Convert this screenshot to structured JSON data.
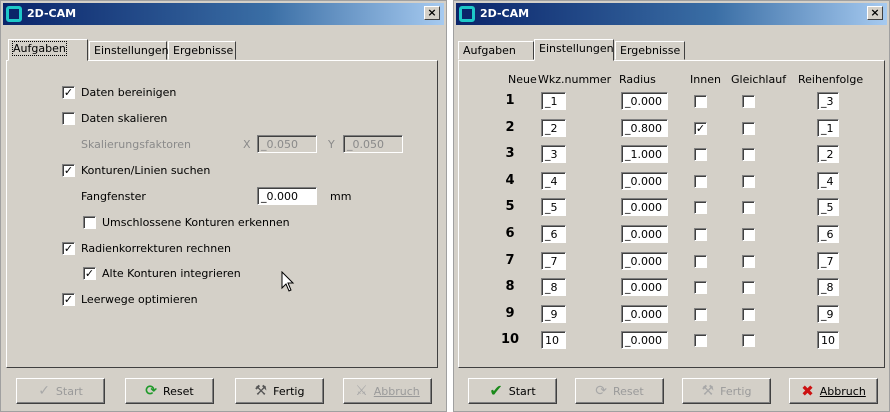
{
  "left": {
    "title": "2D-CAM",
    "close": "×",
    "tabs": [
      "Aufgaben",
      "Einstellungen",
      "Ergebnisse"
    ],
    "options": {
      "daten_bereinigen": {
        "label": "Daten bereinigen",
        "checked": true
      },
      "daten_skalieren": {
        "label": "Daten skalieren",
        "checked": false
      },
      "skalierungsfaktoren": {
        "label": "Skalierungsfaktoren",
        "x_label": "X",
        "x_value": "_0.050",
        "y_label": "Y",
        "y_value": "_0.050"
      },
      "konturen_suchen": {
        "label": "Konturen/Linien suchen",
        "checked": true
      },
      "fangfenster": {
        "label": "Fangfenster",
        "value": "_0.000",
        "unit": "mm"
      },
      "umschlossene": {
        "label": "Umschlossene Konturen erkennen",
        "checked": false
      },
      "radienkorrekturen": {
        "label": "Radienkorrekturen rechnen",
        "checked": true
      },
      "alte_konturen": {
        "label": "Alte Konturen integrieren",
        "checked": true
      },
      "leerwege": {
        "label": "Leerwege optimieren",
        "checked": true
      }
    },
    "buttons": {
      "start": "Start",
      "reset": "Reset",
      "fertig": "Fertig",
      "abbruch": "Abbruch"
    },
    "icons": {
      "start": "checkmark-icon",
      "reset": "refresh-icon",
      "fertig": "tools-icon",
      "abbruch": "tools-cross-icon"
    }
  },
  "right": {
    "title": "2D-CAM",
    "close": "×",
    "tabs": [
      "Aufgaben",
      "Einstellungen",
      "Ergebnisse"
    ],
    "headers": {
      "neue": "Neue",
      "wkz": "Wkz.nummer",
      "radius": "Radius",
      "innen": "Innen",
      "gleichlauf": "Gleichlauf",
      "reihenfolge": "Reihenfolge"
    },
    "rows": [
      {
        "num": "1",
        "wkz": "_1",
        "radius": "_0.000",
        "innen": false,
        "gleichlauf": false,
        "reihenfolge": "_3"
      },
      {
        "num": "2",
        "wkz": "_2",
        "radius": "_0.800",
        "innen": true,
        "gleichlauf": false,
        "reihenfolge": "_1"
      },
      {
        "num": "3",
        "wkz": "_3",
        "radius": "_1.000",
        "innen": false,
        "gleichlauf": false,
        "reihenfolge": "_2"
      },
      {
        "num": "4",
        "wkz": "_4",
        "radius": "_0.000",
        "innen": false,
        "gleichlauf": false,
        "reihenfolge": "_4"
      },
      {
        "num": "5",
        "wkz": "_5",
        "radius": "_0.000",
        "innen": false,
        "gleichlauf": false,
        "reihenfolge": "_5"
      },
      {
        "num": "6",
        "wkz": "_6",
        "radius": "_0.000",
        "innen": false,
        "gleichlauf": false,
        "reihenfolge": "_6"
      },
      {
        "num": "7",
        "wkz": "_7",
        "radius": "_0.000",
        "innen": false,
        "gleichlauf": false,
        "reihenfolge": "_7"
      },
      {
        "num": "8",
        "wkz": "_8",
        "radius": "_0.000",
        "innen": false,
        "gleichlauf": false,
        "reihenfolge": "_8"
      },
      {
        "num": "9",
        "wkz": "_9",
        "radius": "_0.000",
        "innen": false,
        "gleichlauf": false,
        "reihenfolge": "_9"
      },
      {
        "num": "10",
        "wkz": "10",
        "radius": "_0.000",
        "innen": false,
        "gleichlauf": false,
        "reihenfolge": "10"
      }
    ],
    "buttons": {
      "start": "Start",
      "reset": "Reset",
      "fertig": "Fertig",
      "abbruch": "Abbruch"
    },
    "icons": {
      "start": "checkmark-icon",
      "reset": "refresh-icon",
      "fertig": "tools-icon",
      "abbruch": "red-x-icon"
    },
    "colors": {
      "start_check": "#1a8a1a",
      "abbruch_x": "#cc1111"
    }
  },
  "colors": {
    "titlebar_start": "#0a246a",
    "titlebar_end": "#a6caf0",
    "window": "#d4d0c8",
    "reset_icon": "#1f9a2a"
  }
}
